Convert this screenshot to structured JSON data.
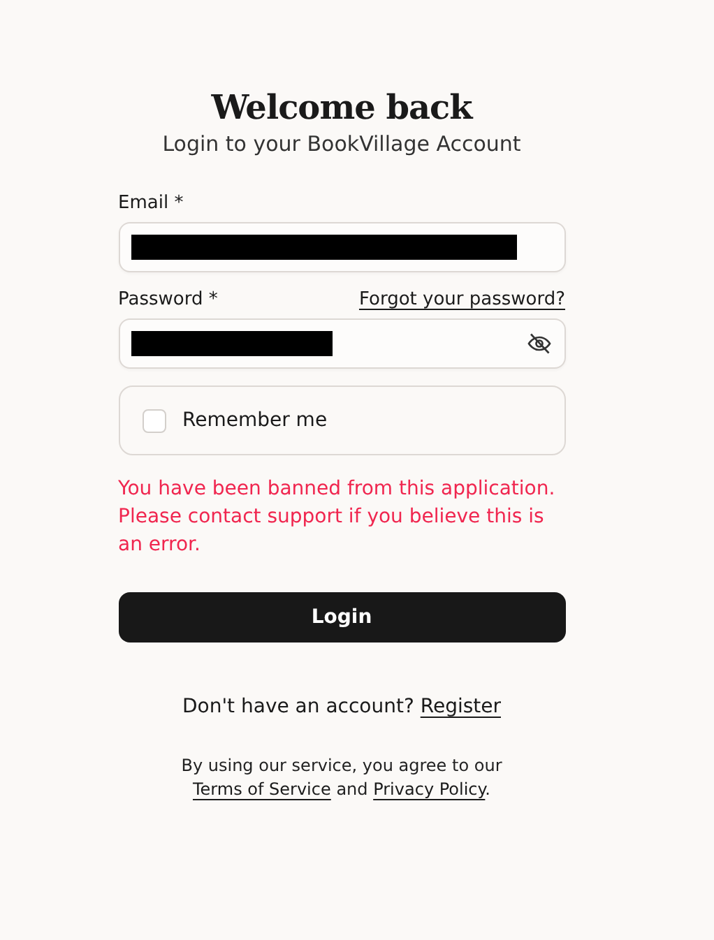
{
  "title": "Welcome back",
  "subtitle": "Login to your BookVillage Account",
  "fields": [
    {
      "kind": "email",
      "label": "Email *",
      "redacted": true
    },
    {
      "kind": "password",
      "label": "Password *",
      "link": "Forgot your password?",
      "redacted": true
    }
  ],
  "remember": {
    "label": "Remember me",
    "checked": false
  },
  "error": "You have been banned from this application. Please contact support if you believe this is an error.",
  "login_button": "Login",
  "signup": {
    "text": "Don't have an account?",
    "link": "Register"
  },
  "legal": {
    "before": "By using our service, you agree to our",
    "link_1": "Terms of Service",
    "middle": "and",
    "link_2": "Privacy Policy",
    "end": "."
  }
}
